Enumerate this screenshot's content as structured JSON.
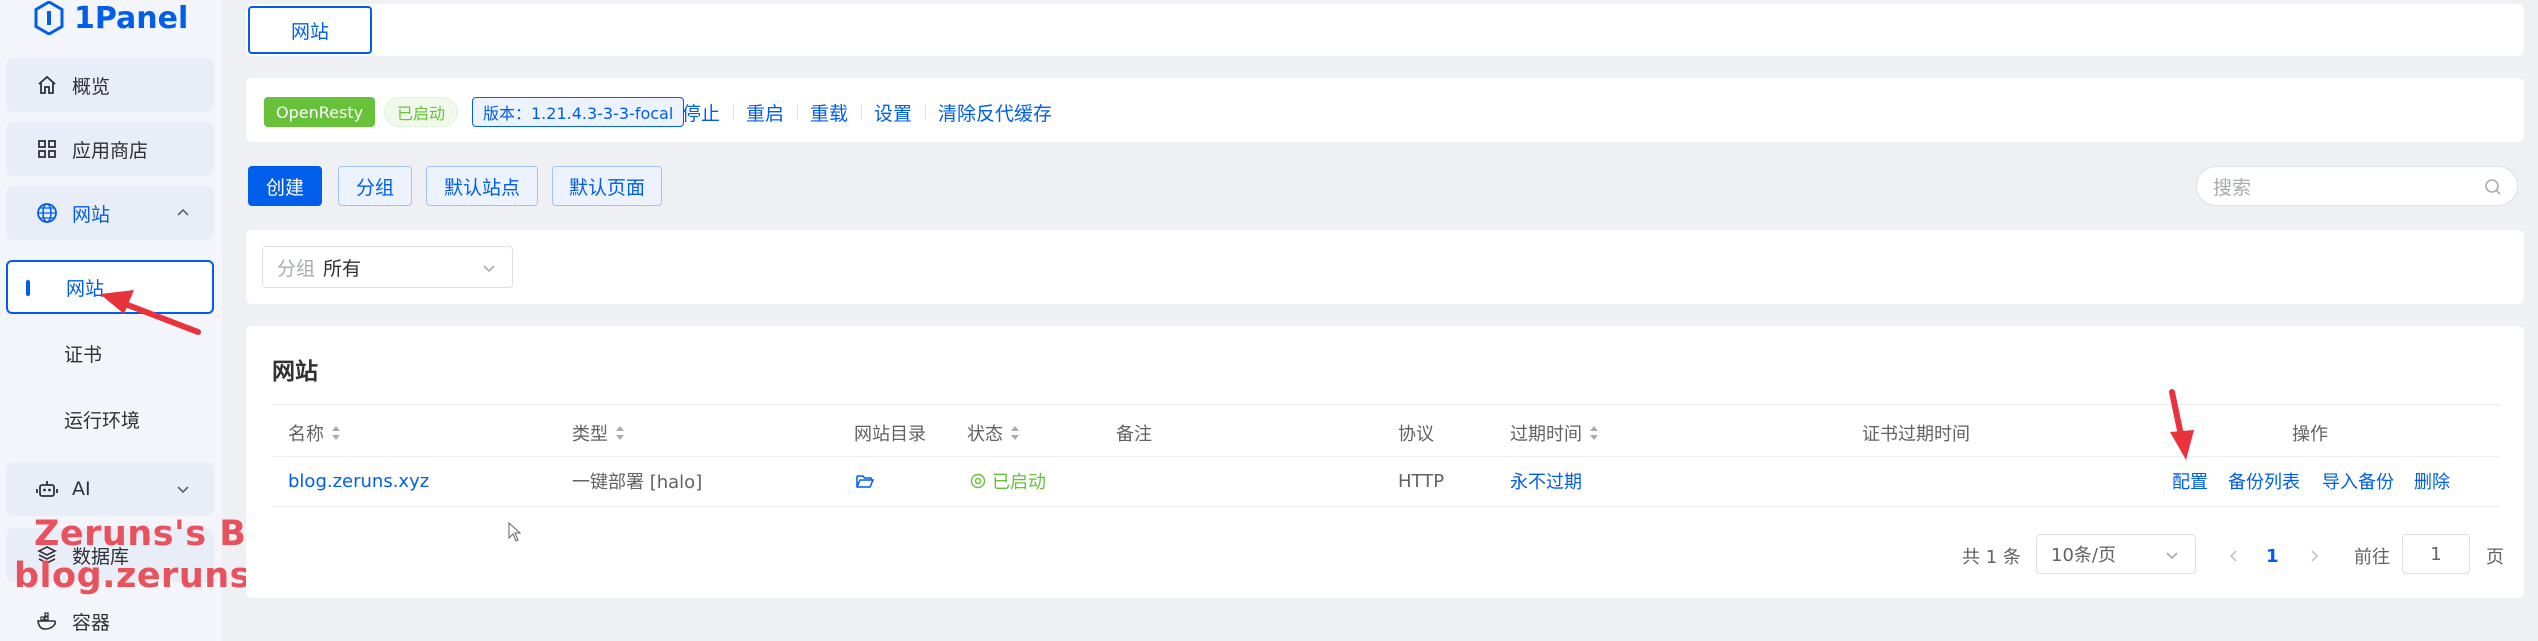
{
  "app": {
    "logo_text": "1Panel",
    "accent": "#005eeb",
    "success": "#67c23a",
    "annotation_color": "#e8323c"
  },
  "sidebar": {
    "items": [
      {
        "label": "概览",
        "icon": "home-icon"
      },
      {
        "label": "应用商店",
        "icon": "grid-icon"
      },
      {
        "label": "网站",
        "icon": "globe-icon",
        "expanded": true
      },
      {
        "label": "AI",
        "icon": "robot-icon"
      },
      {
        "label": "数据库",
        "icon": "database-icon"
      },
      {
        "label": "容器",
        "icon": "container-icon"
      }
    ],
    "website_children": [
      {
        "label": "网站",
        "active": true
      },
      {
        "label": "证书"
      },
      {
        "label": "运行环境"
      }
    ]
  },
  "watermark": {
    "line1": "Zeruns's Blog",
    "line2": "blog.zeruns.com"
  },
  "tabs": [
    {
      "label": "网站",
      "active": true
    }
  ],
  "status_bar": {
    "app_name": "OpenResty",
    "status": "已启动",
    "version": "版本：1.21.4.3-3-3-focal",
    "actions": [
      "停止",
      "重启",
      "重载",
      "设置",
      "清除反代缓存"
    ]
  },
  "toolbar": {
    "buttons": [
      "创建",
      "分组",
      "默认站点",
      "默认页面"
    ],
    "search_placeholder": "搜索"
  },
  "filter": {
    "group_label": "分组",
    "group_value": "所有"
  },
  "table": {
    "title": "网站",
    "columns": [
      "名称",
      "类型",
      "网站目录",
      "状态",
      "备注",
      "协议",
      "过期时间",
      "证书过期时间",
      "操作"
    ],
    "rows": [
      {
        "name": "blog.zeruns.xyz",
        "type": "一键部署 [halo]",
        "dir_icon": "folder-open-icon",
        "status": "已启动",
        "remark": "",
        "protocol": "HTTP",
        "expire": "永不过期",
        "cert_expire": "",
        "actions": [
          "配置",
          "备份列表",
          "导入备份",
          "删除"
        ]
      }
    ]
  },
  "pagination": {
    "total": "共 1 条",
    "page_size": "10条/页",
    "current": "1",
    "goto_label": "前往",
    "goto_value": "1",
    "page_suffix": "页"
  }
}
